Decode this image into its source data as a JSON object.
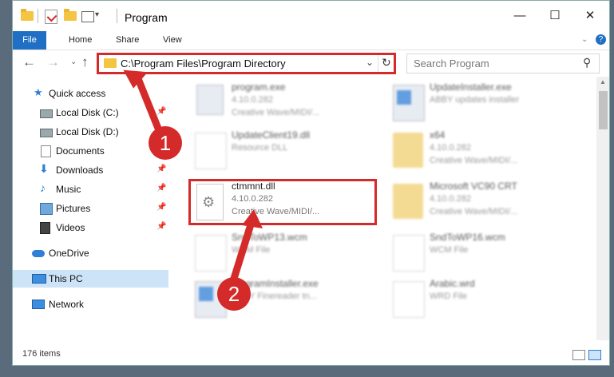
{
  "window": {
    "title": "Program",
    "minimize": "—",
    "maximize": "☐",
    "close": "✕"
  },
  "ribbon": {
    "tabs": [
      "File",
      "Home",
      "Share",
      "View"
    ],
    "help": "?"
  },
  "addressbar": {
    "path": "C:\\Program Files\\Program Directory",
    "search_placeholder": "Search Program"
  },
  "sidebar": {
    "items": [
      {
        "label": "Quick access"
      },
      {
        "label": "Local Disk (C:)"
      },
      {
        "label": "Local Disk (D:)"
      },
      {
        "label": "Documents"
      },
      {
        "label": "Downloads"
      },
      {
        "label": "Music"
      },
      {
        "label": "Pictures"
      },
      {
        "label": "Videos"
      },
      {
        "label": "OneDrive"
      },
      {
        "label": "This PC"
      },
      {
        "label": "Network"
      }
    ]
  },
  "files": {
    "left": [
      {
        "name": "program.exe",
        "line2": "4.10.0.282",
        "line3": "Creative Wave/MIDI/..."
      },
      {
        "name": "UpdateClient19.dll",
        "line2": "Resource DLL",
        "line3": ""
      },
      {
        "name": "ctmmnt.dll",
        "line2": "4.10.0.282",
        "line3": "Creative Wave/MIDI/..."
      },
      {
        "name": "SndToWP13.wcm",
        "line2": "WCM File",
        "line3": ""
      },
      {
        "name": "programInstaller.exe",
        "line2": "ABBY Finereader tn...",
        "line3": ""
      }
    ],
    "right": [
      {
        "name": "UpdateInstaller.exe",
        "line2": "ABBY updates installer",
        "line3": ""
      },
      {
        "name": "x64",
        "line2": "4.10.0.282",
        "line3": "Creative Wave/MIDI/..."
      },
      {
        "name": "Microsoft VC90 CRT",
        "line2": "4.10.0.282",
        "line3": "Creative Wave/MIDI/..."
      },
      {
        "name": "SndToWP16.wcm",
        "line2": "WCM File",
        "line3": ""
      },
      {
        "name": "Arabic.wrd",
        "line2": "WRD File",
        "line3": ""
      }
    ]
  },
  "status": {
    "count": "176 items"
  },
  "callouts": [
    "1",
    "2"
  ],
  "colors": {
    "accent": "#1f6fc5",
    "highlight": "#d42a2a",
    "selected": "#cde3f7"
  }
}
